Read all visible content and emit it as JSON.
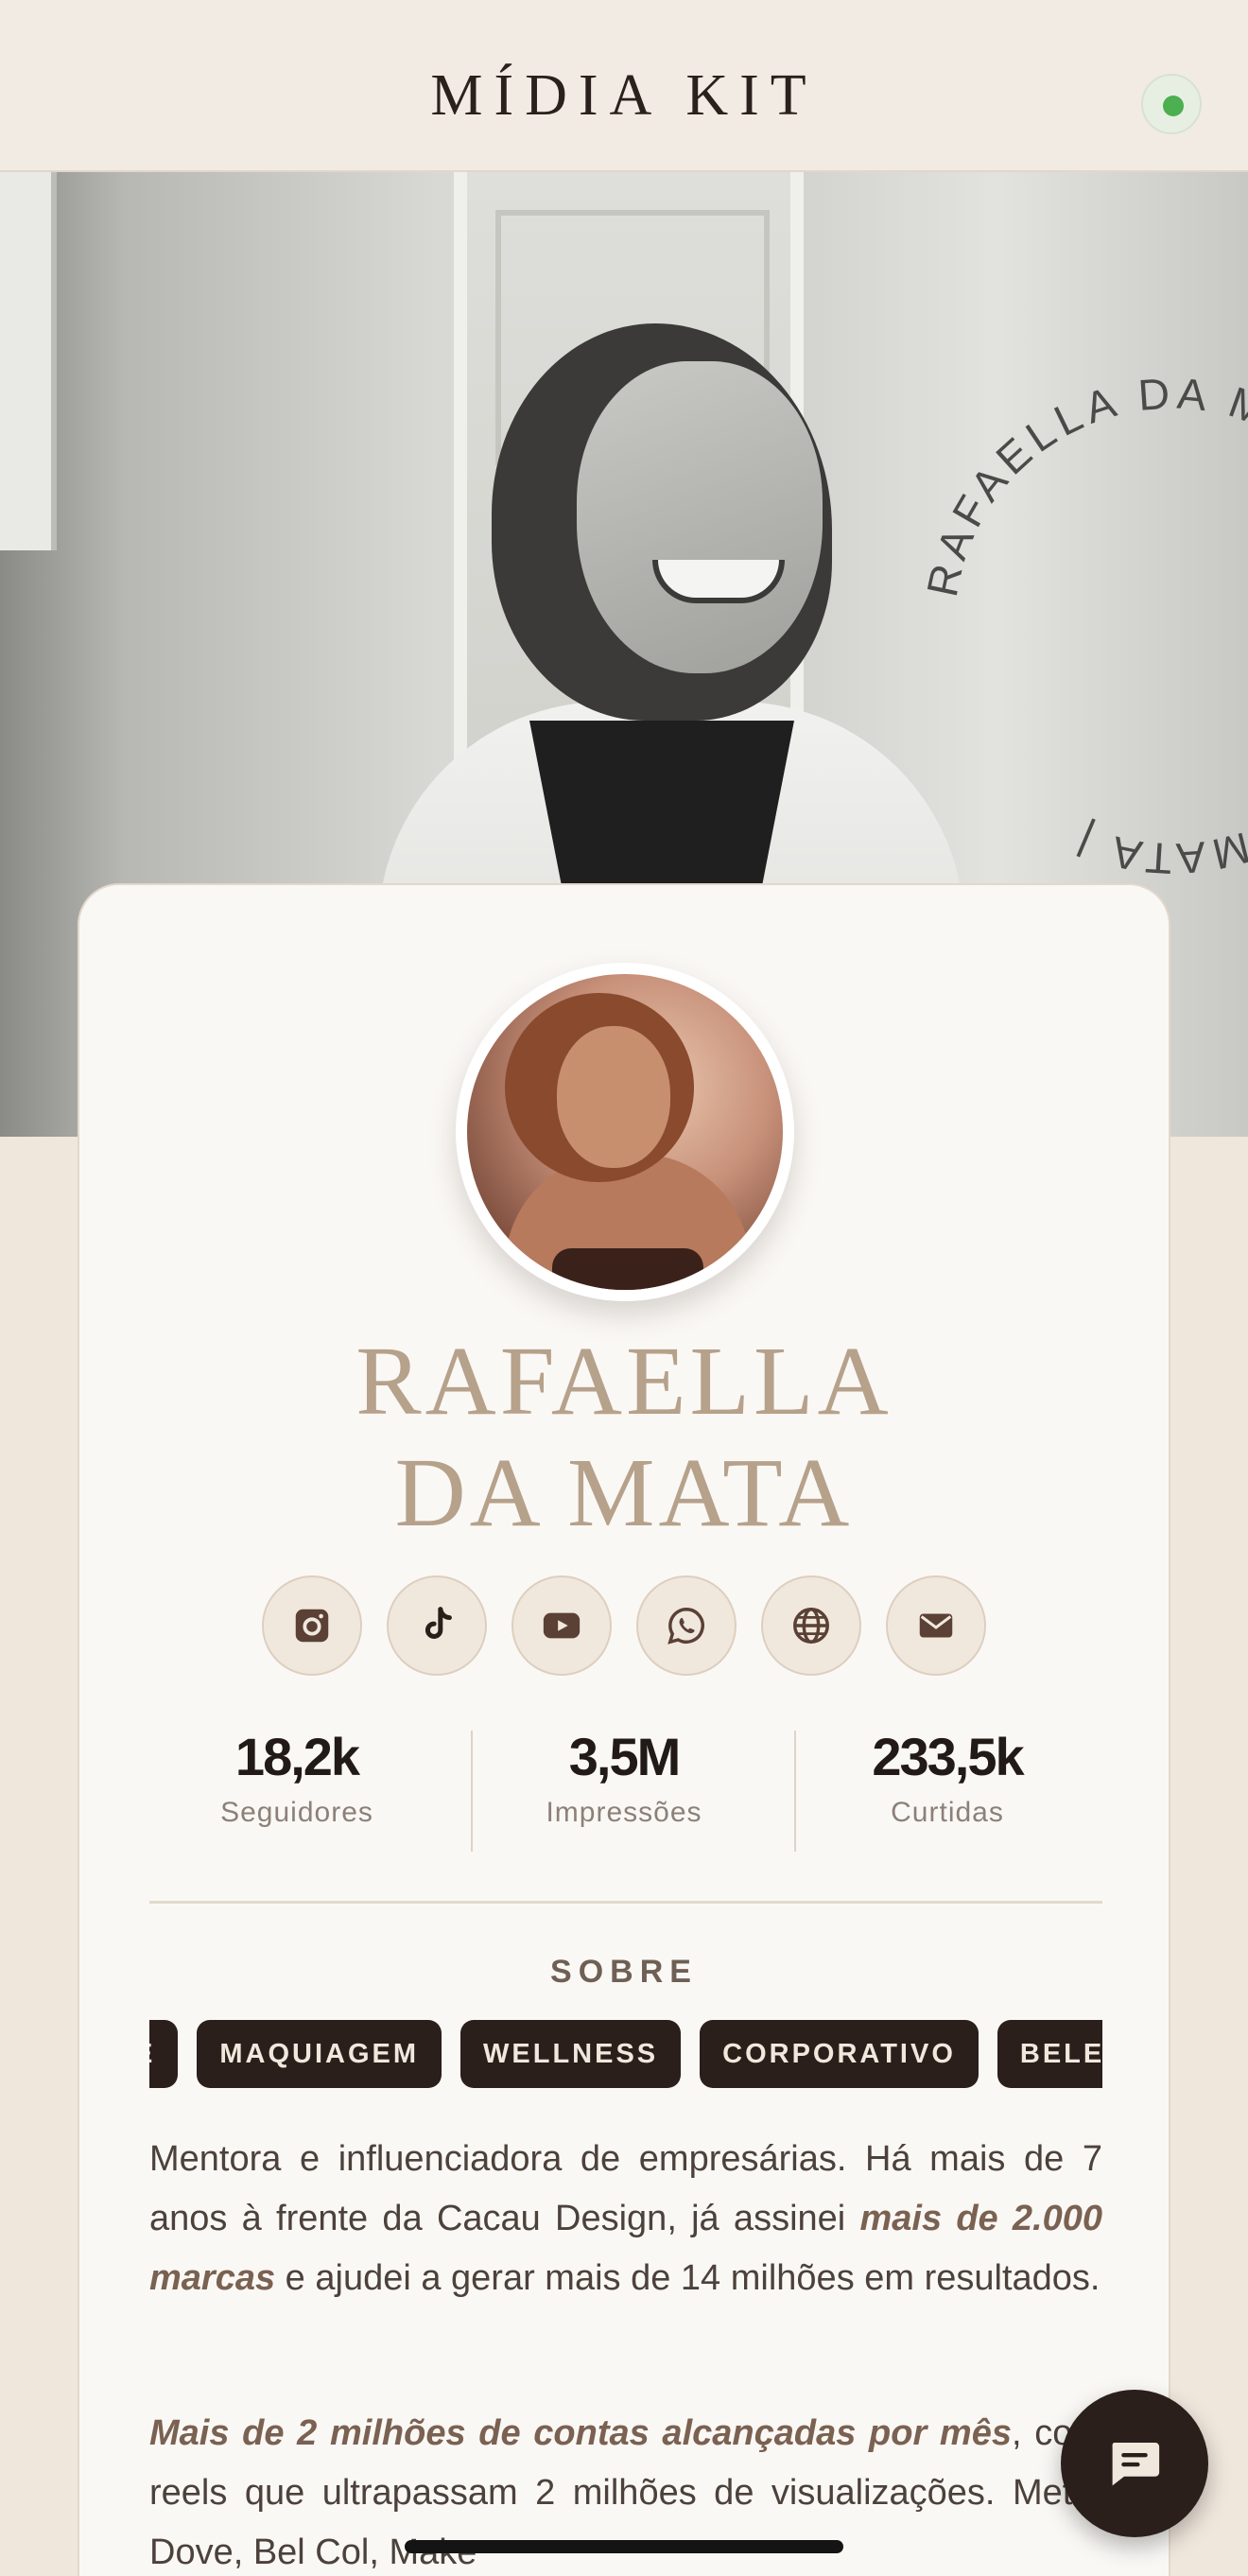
{
  "header": {
    "title": "MÍDIA KIT",
    "status": "online"
  },
  "hero": {
    "circular_text": "RAFAELLA DA MATA | RAFAELLA DA MATA | "
  },
  "profile": {
    "name_line1": "RAFAELLA",
    "name_line2": "DA MATA",
    "socials": [
      {
        "icon": "instagram-icon"
      },
      {
        "icon": "tiktok-icon"
      },
      {
        "icon": "youtube-icon"
      },
      {
        "icon": "whatsapp-icon"
      },
      {
        "icon": "globe-icon"
      },
      {
        "icon": "mail-icon"
      }
    ],
    "stats": [
      {
        "value": "18,2k",
        "label": "Seguidores"
      },
      {
        "value": "3,5M",
        "label": "Impressões"
      },
      {
        "value": "233,5k",
        "label": "Curtidas"
      }
    ]
  },
  "about": {
    "title": "SOBRE",
    "tags": [
      "E",
      "MAQUIAGEM",
      "WELLNESS",
      "CORPORATIVO",
      "BELEZA"
    ],
    "p1_a": "Mentora e influenciadora de empresárias. Há mais de 7 anos à frente da Cacau Design, já assinei ",
    "p1_b": "mais de 2.000 marcas",
    "p1_c": " e ajudei a gerar mais de 14 milhões em resultados.",
    "p2_a": "Mais de 2 milhões de contas alcançadas por mês",
    "p2_b": ", com reels que ultrapassam 2 milhões de visualizações. Meta, Dove, Bel Col, Make"
  },
  "colors": {
    "accent": "#b6a18b",
    "dark": "#2a1f1a",
    "background": "#efe6dc",
    "status": "#4caf50"
  },
  "fab": {
    "icon": "chat-icon"
  }
}
